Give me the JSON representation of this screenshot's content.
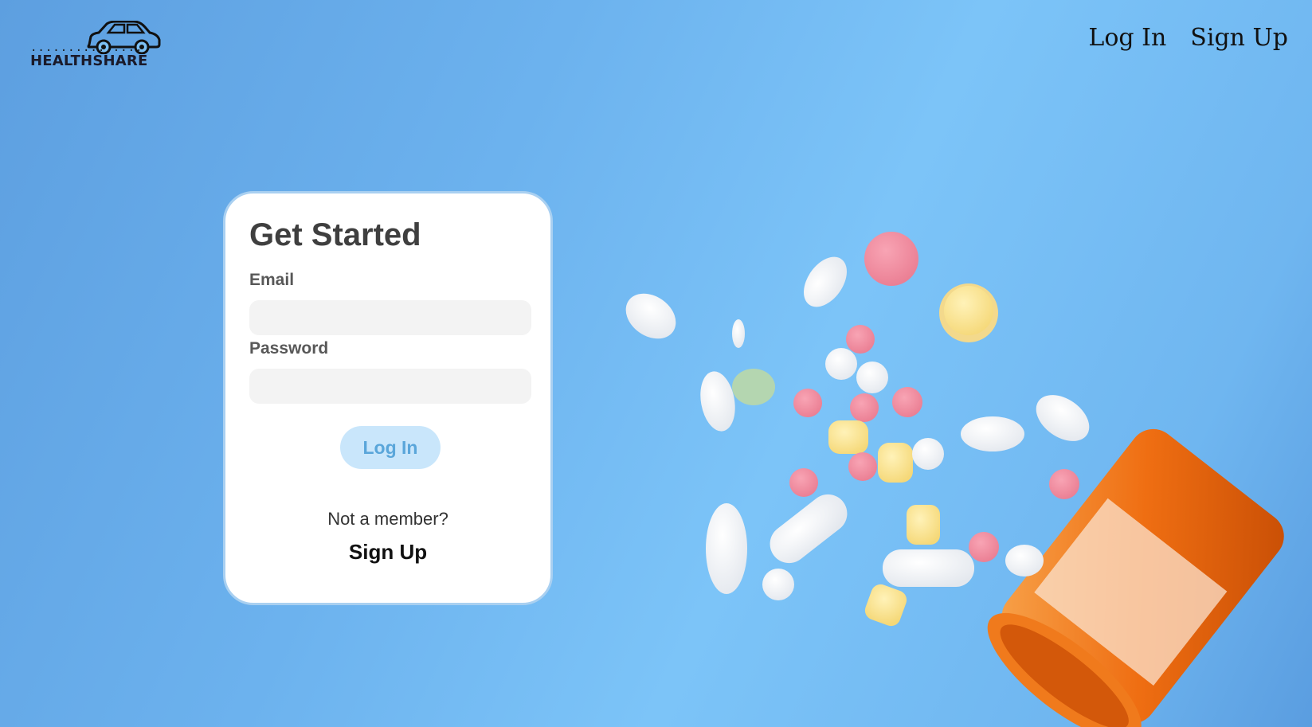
{
  "brand": {
    "name": "HEALTHSHARE",
    "dots": "..............."
  },
  "nav": {
    "login_label": "Log In",
    "signup_label": "Sign Up"
  },
  "card": {
    "title": "Get Started",
    "email_label": "Email",
    "email_placeholder": "",
    "password_label": "Password",
    "password_placeholder": "",
    "login_button": "Log In",
    "not_member": "Not a member?",
    "signup_link": "Sign Up"
  },
  "colors": {
    "background": "#6cb2ee",
    "card_border": "#a9d0f1",
    "button_bg": "#c9e6fb",
    "button_text": "#5aa6da",
    "input_bg": "#f3f3f3",
    "bottle": "#f07a1c"
  },
  "icons": {
    "logo": "car-icon"
  }
}
